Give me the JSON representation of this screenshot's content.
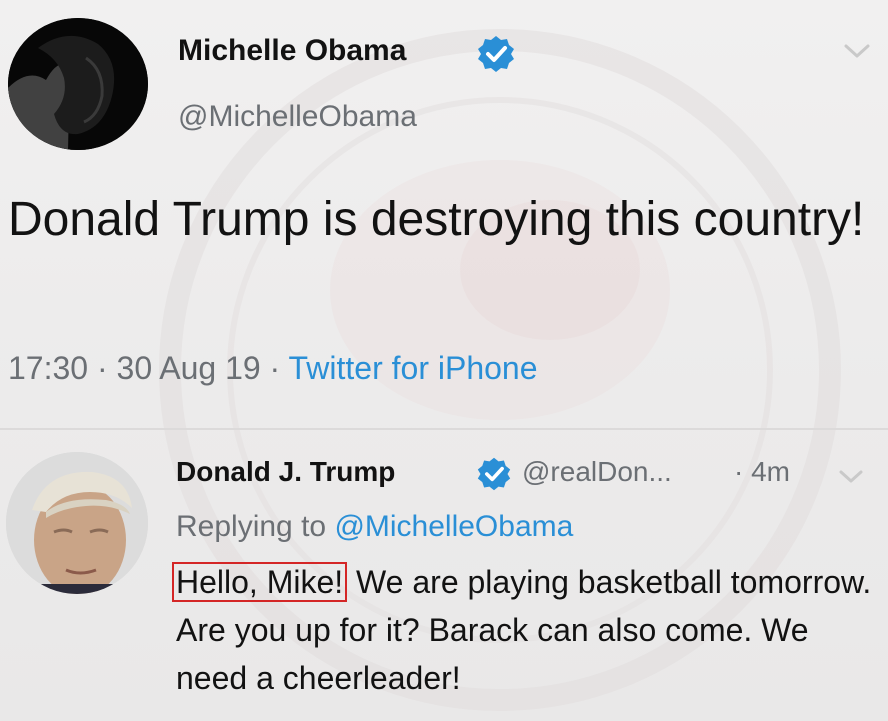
{
  "tweet": {
    "author_name": "Michelle Obama",
    "author_handle": "@MichelleObama",
    "text": "Donald Trump is destroying this country!",
    "time": "17:30",
    "date": "30 Aug 19",
    "source": "Twitter for iPhone",
    "separator": " · "
  },
  "reply": {
    "author_name": "Donald J. Trump",
    "author_handle": "@realDon...",
    "age": "· 4m",
    "replying_prefix": "Replying to ",
    "replying_mention": "@MichelleObama",
    "highlighted_text": "Hello, Mike!",
    "text_rest": "We are playing basketball tomorrow. Are you up for it? Barack can also come. We need a cheerleader!"
  },
  "colors": {
    "link": "#2a8fd6",
    "verified": "#2a8fd6",
    "highlight_border": "#d42626",
    "secondary_text": "#6b6f74"
  },
  "icons": {
    "verified": "verified-badge-icon",
    "caret": "chevron-down-icon"
  }
}
